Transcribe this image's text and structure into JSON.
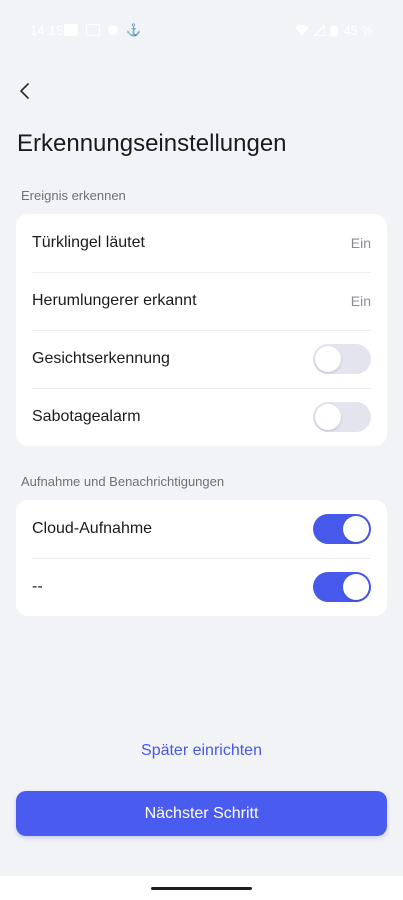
{
  "status_bar": {
    "time": "14:15",
    "battery": "45 %"
  },
  "header": {
    "title": "Erkennungseinstellungen"
  },
  "section_detect": {
    "label": "Ereignis erkennen",
    "rows": [
      {
        "label": "Türklingel läutet",
        "value": "Ein"
      },
      {
        "label": "Herumlungerer erkannt",
        "value": "Ein"
      },
      {
        "label": "Gesichtserkennung",
        "toggle": false
      },
      {
        "label": "Sabotagealarm",
        "toggle": false
      }
    ]
  },
  "section_record": {
    "label": "Aufnahme und Benachrichtigungen",
    "rows": [
      {
        "label": "Cloud-Aufnahme",
        "toggle": true
      },
      {
        "label": "--",
        "toggle": true
      }
    ]
  },
  "actions": {
    "later": "Später einrichten",
    "next": "Nächster Schritt"
  },
  "colors": {
    "accent": "#4a5cf0",
    "background": "#f2f3f7",
    "toggle_off": "#e3e4ee"
  }
}
